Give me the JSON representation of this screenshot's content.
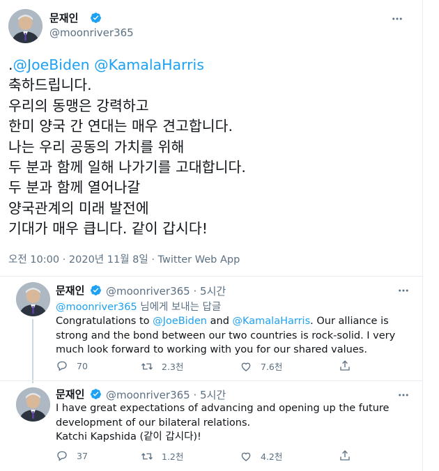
{
  "main_tweet": {
    "name": "문재인",
    "handle": "@moonriver365",
    "lead": ".",
    "mention1": "@JoeBiden",
    "mention2": "@KamalaHarris",
    "body": "축하드립니다.\n우리의 동맹은 강력하고\n한미 양국 간 연대는 매우 견고합니다.\n나는 우리 공동의 가치를 위해\n두 분과 함께 일해 나가기를 고대합니다.\n두 분과 함께 열어나갈\n양국관계의 미래 발전에\n기대가 매우 큽니다. 같이 갑시다!",
    "meta": "오전 10:00 · 2020년 11월 8일 · Twitter Web App"
  },
  "reply1": {
    "name": "문재인",
    "handle": "@moonriver365",
    "time": "· 5시간",
    "reply_to_handle": "@moonriver365",
    "reply_to_suffix": "님에게 보내는 답글",
    "text_start": "Congratulations to",
    "mention1": "@JoeBiden",
    "text_and": "and",
    "mention2": "@KamalaHarris",
    "text_rest": ". Our alliance is strong and the bond between our two countries is rock-solid. I very much look forward to working with you for our shared values.",
    "replies": "70",
    "retweets": "2.3천",
    "likes": "7.6천"
  },
  "reply2": {
    "name": "문재인",
    "handle": "@moonriver365",
    "time": "· 5시간",
    "line1": "I have great expectations of advancing and opening up the future",
    "line2": "development of our bilateral relations.",
    "line3": "Katchi Kapshida (같이 갑시다)!",
    "replies": "37",
    "retweets": "1.2천",
    "likes": "4.2천"
  },
  "colors": {
    "link": "#1da1f2",
    "secondary": "#5b7083",
    "text": "#0f1419",
    "divider": "#e6ecf0"
  },
  "icons": [
    "verified-badge-icon",
    "more-options-icon",
    "reply-icon",
    "retweet-icon",
    "like-icon",
    "share-icon"
  ]
}
